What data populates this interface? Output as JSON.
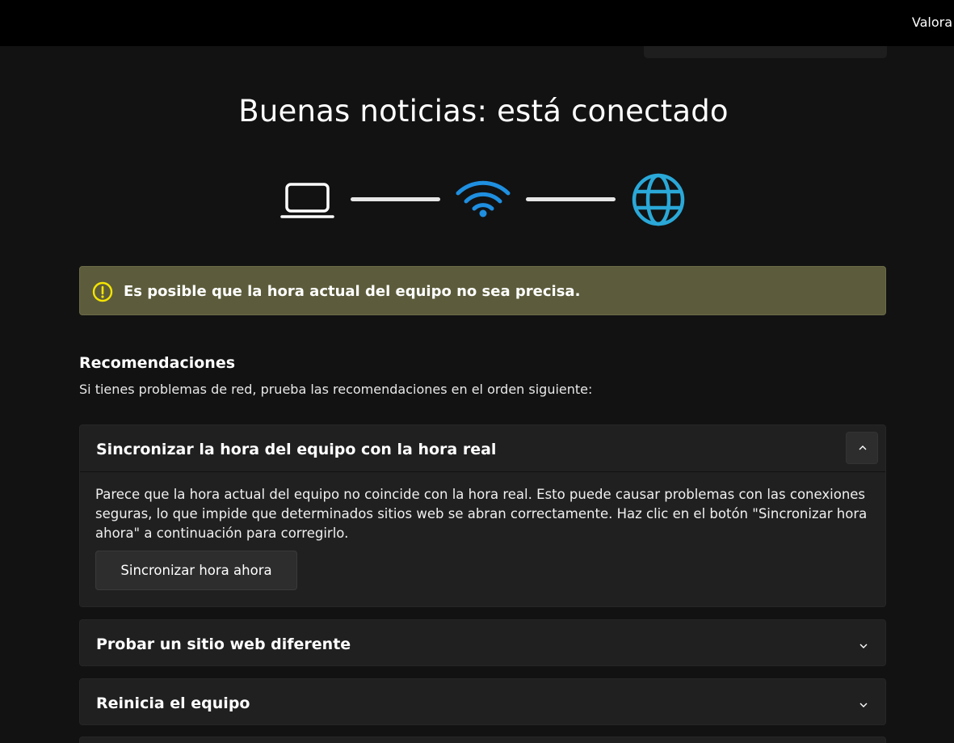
{
  "topbar": {
    "label": "Valora"
  },
  "hero": {
    "title": "Buenas noticias: está conectado"
  },
  "status_icons": {
    "device": "laptop-icon",
    "network": "wifi-icon",
    "internet": "globe-icon",
    "network_color": "#1f8fe0",
    "internet_color": "#2aa8d8"
  },
  "warning": {
    "icon": "warning-icon",
    "text": "Es posible que la hora actual del equipo no sea precisa.",
    "color": "#5c5c3c",
    "icon_color": "#f5e400"
  },
  "recommendations": {
    "title": "Recomendaciones",
    "subtitle": "Si tienes problemas de red, prueba las recomendaciones en el orden siguiente:",
    "items": [
      {
        "title": "Sincronizar la hora del equipo con la hora real",
        "expanded": true,
        "body": "Parece que la hora actual del equipo no coincide con la hora real. Esto puede causar problemas con las conexiones seguras, lo que impide que determinados sitios web se abran correctamente. Haz clic en el botón \"Sincronizar hora ahora\" a continuación para corregirlo.",
        "action_label": "Sincronizar hora ahora"
      },
      {
        "title": "Probar un sitio web diferente",
        "expanded": false
      },
      {
        "title": "Reinicia el equipo",
        "expanded": false
      }
    ]
  }
}
